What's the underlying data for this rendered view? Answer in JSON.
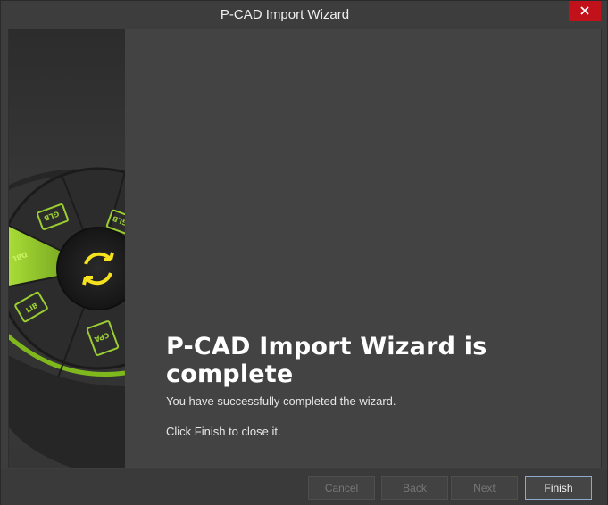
{
  "window": {
    "title": "P-CAD Import Wizard"
  },
  "main": {
    "heading": "P-CAD Import Wizard is complete",
    "message_1": "You have successfully completed the wizard.",
    "message_2": "Click Finish to close it."
  },
  "banner": {
    "wheel_labels": [
      "GLB",
      "GLB",
      "DBL",
      "LIB",
      "CPA"
    ]
  },
  "footer": {
    "cancel_label": "Cancel",
    "back_label": "Back",
    "next_label": "Next",
    "finish_label": "Finish"
  },
  "colors": {
    "accent_green": "#9acd32",
    "close_red": "#c1121c",
    "icon_yellow": "#f5e11e"
  }
}
